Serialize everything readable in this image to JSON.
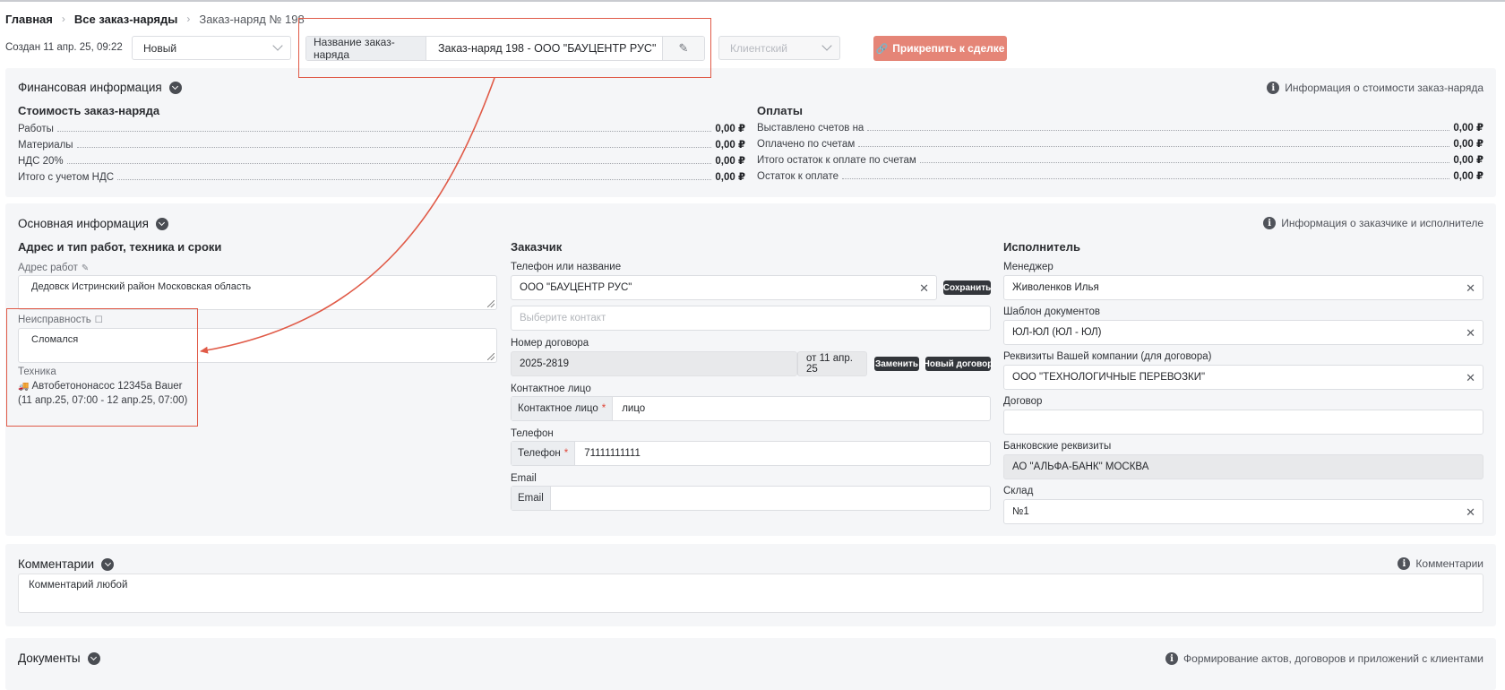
{
  "breadcrumb": {
    "home": "Главная",
    "orders": "Все заказ-наряды",
    "current": "Заказ-наряд № 198"
  },
  "header": {
    "created": "Создан 11 апр. 25, 09:22",
    "status": "Новый",
    "title_label": "Название заказ-наряда",
    "title_value": "Заказ-наряд 198 - ООО \"БАУЦЕНТР РУС\"",
    "client_type": "Клиентский",
    "attach_button": "Прикрепить к сделке"
  },
  "financial": {
    "title": "Финансовая информация",
    "info_link": "Информация о стоимости заказ-наряда",
    "cost": {
      "title": "Стоимость заказ-наряда",
      "rows": [
        {
          "label": "Работы",
          "value": "0,00 ₽"
        },
        {
          "label": "Материалы",
          "value": "0,00 ₽"
        },
        {
          "label": "НДС 20%",
          "value": "0,00 ₽"
        },
        {
          "label": "Итого с учетом НДС",
          "value": "0,00 ₽"
        }
      ]
    },
    "payments": {
      "title": "Оплаты",
      "rows": [
        {
          "label": "Выставлено счетов на",
          "value": "0,00 ₽"
        },
        {
          "label": "Оплачено по счетам",
          "value": "0,00 ₽"
        },
        {
          "label": "Итого остаток к оплате по счетам",
          "value": "0,00 ₽"
        },
        {
          "label": "Остаток к оплате",
          "value": "0,00 ₽"
        }
      ]
    }
  },
  "main_info": {
    "title": "Основная информация",
    "info_link": "Информация о заказчике и исполнителе",
    "address_col": {
      "title": "Адрес и тип работ, техника и сроки",
      "address_label": "Адрес работ",
      "address_value": "Дедовск Истринский район Московская область",
      "fault_label": "Неисправность",
      "fault_value": "Сломался",
      "equipment_label": "Техника",
      "equipment_name": "Автобетононасос 12345а Bauer",
      "equipment_period": "(11 апр.25, 07:00 - 12 апр.25, 07:00)"
    },
    "customer_col": {
      "title": "Заказчик",
      "phone_or_name_label": "Телефон или название",
      "phone_or_name_value": "ООО \"БАУЦЕНТР РУС\"",
      "save_button": "Сохранить",
      "contact_placeholder": "Выберите контакт",
      "contract_label": "Номер договора",
      "contract_value": "2025-2819",
      "contract_date": "от 11 апр. 25",
      "replace_button": "Заменить",
      "new_contract_button": "Новый договор",
      "contact_person_label": "Контактное лицо",
      "contact_person_addon": "Контактное лицо",
      "contact_person_value": "лицо",
      "phone_label": "Телефон",
      "phone_addon": "Телефон",
      "phone_value": "71111111111",
      "email_label": "Email",
      "email_addon": "Email",
      "email_value": ""
    },
    "executor_col": {
      "title": "Исполнитель",
      "manager_label": "Менеджер",
      "manager_value": "Живоленков Илья",
      "template_label": "Шаблон документов",
      "template_value": "ЮЛ-ЮЛ (ЮЛ - ЮЛ)",
      "company_details_label": "Реквизиты Вашей компании (для договора)",
      "company_details_value": "ООО \"ТЕХНОЛОГИЧНЫЕ ПЕРЕВОЗКИ\"",
      "contract_label": "Договор",
      "contract_value": "",
      "bank_label": "Банковские реквизиты",
      "bank_value": "АО \"АЛЬФА-БАНК\" МОСКВА",
      "warehouse_label": "Склад",
      "warehouse_value": "№1"
    }
  },
  "comments": {
    "title": "Комментарии",
    "info_link": "Комментарии",
    "value": "Комментарий любой"
  },
  "documents": {
    "title": "Документы",
    "info_link": "Формирование актов, договоров и приложений с клиентами"
  },
  "colors": {
    "accent_button": "#e58577",
    "annotation": "#e05a47",
    "panel_bg": "#f5f6f8"
  }
}
